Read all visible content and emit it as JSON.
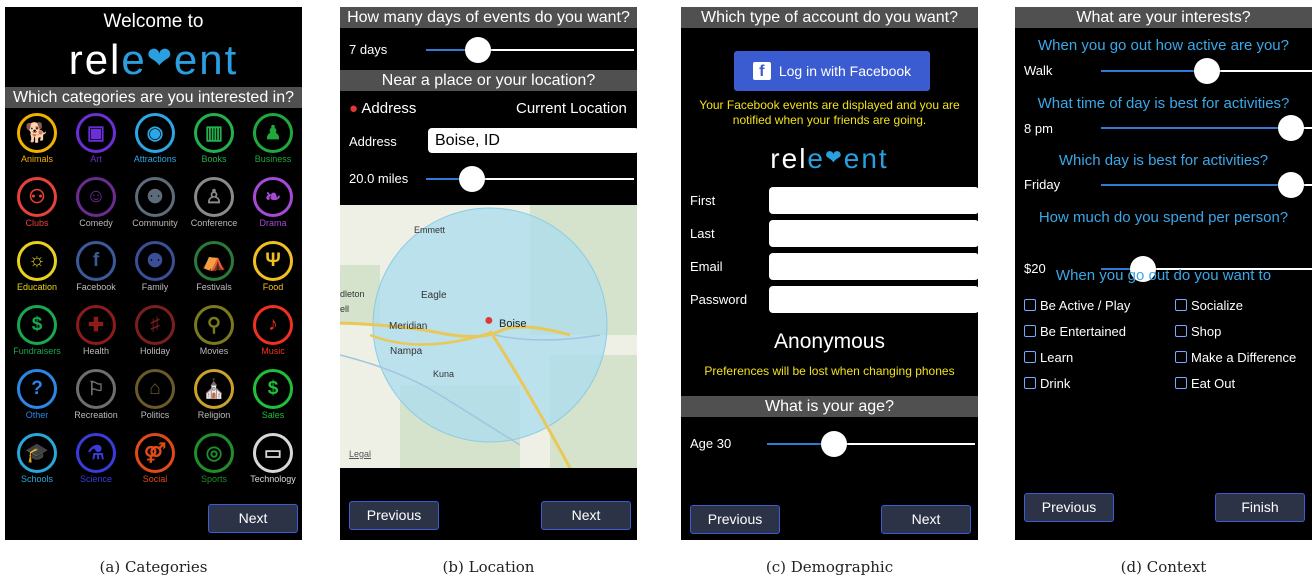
{
  "panel_a": {
    "welcome": "Welcome to",
    "logo": "relevent",
    "header": "Which categories are you interested in?",
    "categories": [
      {
        "label": "Animals",
        "color": "#f2b300",
        "icon": "dog-icon",
        "glyph": "🐕"
      },
      {
        "label": "Art",
        "color": "#6a2fd6",
        "icon": "easel-icon",
        "glyph": "▣"
      },
      {
        "label": "Attractions",
        "color": "#2da6e6",
        "icon": "camera-icon",
        "glyph": "◉"
      },
      {
        "label": "Books",
        "color": "#22b14c",
        "icon": "book-icon",
        "glyph": "▥"
      },
      {
        "label": "Business",
        "color": "#1fa83c",
        "icon": "businessman-icon",
        "glyph": "♟"
      },
      {
        "label": "Clubs",
        "color": "#e6423a",
        "icon": "people-icon",
        "glyph": "⚇"
      },
      {
        "label": "Comedy",
        "color": "#6b2c8f",
        "icon": "masks-icon",
        "glyph": "☺"
      },
      {
        "label": "Community",
        "color": "#5e6b7a",
        "icon": "group-icon",
        "glyph": "⚉"
      },
      {
        "label": "Conference",
        "color": "#8a8a8a",
        "icon": "podium-icon",
        "glyph": "♙"
      },
      {
        "label": "Drama",
        "color": "#a64ad6",
        "icon": "drama-masks-icon",
        "glyph": "❧"
      },
      {
        "label": "Education",
        "color": "#e6d21f",
        "icon": "lightbulb-icon",
        "glyph": "☼"
      },
      {
        "label": "Facebook",
        "color": "#3b5a9a",
        "icon": "facebook-icon",
        "glyph": "f"
      },
      {
        "label": "Family",
        "color": "#3a4f96",
        "icon": "family-icon",
        "glyph": "⚉"
      },
      {
        "label": "Festivals",
        "color": "#2b7a3a",
        "icon": "tent-icon",
        "glyph": "⛺"
      },
      {
        "label": "Food",
        "color": "#f0c020",
        "icon": "fork-knife-icon",
        "glyph": "Ψ"
      },
      {
        "label": "Fundraisers",
        "color": "#19a850",
        "icon": "donation-icon",
        "glyph": "$"
      },
      {
        "label": "Health",
        "color": "#8c1c1c",
        "icon": "health-cross-icon",
        "glyph": "✚"
      },
      {
        "label": "Holiday",
        "color": "#7a1e1e",
        "icon": "candy-cane-icon",
        "glyph": "♯"
      },
      {
        "label": "Movies",
        "color": "#7a7a1a",
        "icon": "film-camera-icon",
        "glyph": "⚲"
      },
      {
        "label": "Music",
        "color": "#f03020",
        "icon": "music-note-icon",
        "glyph": "♪"
      },
      {
        "label": "Other",
        "color": "#2d86e6",
        "icon": "question-icon",
        "glyph": "?"
      },
      {
        "label": "Recreation",
        "color": "#6e6e6e",
        "icon": "runner-icon",
        "glyph": "⚐"
      },
      {
        "label": "Politics",
        "color": "#6a5a2a",
        "icon": "capitol-icon",
        "glyph": "⌂"
      },
      {
        "label": "Religion",
        "color": "#c9a22a",
        "icon": "church-icon",
        "glyph": "⛪"
      },
      {
        "label": "Sales",
        "color": "#1fbf3a",
        "icon": "dollar-icon",
        "glyph": "$"
      },
      {
        "label": "Schools",
        "color": "#28a8d8",
        "icon": "graduation-cap-icon",
        "glyph": "🎓"
      },
      {
        "label": "Science",
        "color": "#3b3bdc",
        "icon": "flask-icon",
        "glyph": "⚗"
      },
      {
        "label": "Social",
        "color": "#e04a18",
        "icon": "couple-icon",
        "glyph": "⚤"
      },
      {
        "label": "Sports",
        "color": "#1f8f2a",
        "icon": "stadium-icon",
        "glyph": "◎"
      },
      {
        "label": "Technology",
        "color": "#d8d8d8",
        "icon": "laptop-icon",
        "glyph": "▭"
      }
    ],
    "next": "Next"
  },
  "panel_b": {
    "days_header": "How many days of events do you want?",
    "days_value": "7 days",
    "days_slider": 0.25,
    "place_header": "Near a place or your location?",
    "address_option": "Address",
    "current_location_option": "Current Location",
    "address_label": "Address",
    "address_value": "Boise, ID",
    "radius_value": "20.0 miles",
    "radius_slider": 0.22,
    "map": {
      "cities": [
        "Emmett",
        "Eagle",
        "Meridian",
        "Boise",
        "Nampa",
        "Kuna"
      ],
      "partial_label": "dleton",
      "partial_label_2": "ell",
      "legal": "Legal"
    },
    "previous": "Previous",
    "next": "Next"
  },
  "panel_c": {
    "header": "Which type of account do you want?",
    "facebook_button": "Log in with Facebook",
    "facebook_note": "Your Facebook events are displayed and you are notified when your friends are going.",
    "logo": "relevent",
    "fields": [
      {
        "label": "First",
        "value": ""
      },
      {
        "label": "Last",
        "value": ""
      },
      {
        "label": "Email",
        "value": ""
      },
      {
        "label": "Password",
        "value": ""
      }
    ],
    "anonymous": "Anonymous",
    "anonymous_note": "Preferences will be lost when changing phones",
    "age_header": "What is your age?",
    "age_value": "Age 30",
    "age_slider": 0.32,
    "previous": "Previous",
    "next": "Next"
  },
  "panel_d": {
    "header": "What are your interests?",
    "q1": "When you go out how active are you?",
    "q1_value": "Walk",
    "q1_slider": 0.5,
    "q2": "What time of day is best for activities?",
    "q2_value": "8 pm",
    "q2_slider": 0.9,
    "q3": "Which day is best for activities?",
    "q3_value": "Friday",
    "q3_slider": 0.9,
    "q4": "How much do you spend per person?",
    "q4_value": "$20",
    "q4_slider": 0.2,
    "q5": "When you go out do you want to",
    "options_left": [
      "Be Active / Play",
      "Be Entertained",
      "Learn",
      "Drink"
    ],
    "options_right": [
      "Socialize",
      "Shop",
      "Make a Difference",
      "Eat Out"
    ],
    "previous": "Previous",
    "finish": "Finish"
  },
  "captions": [
    "(a) Categories",
    "(b) Location",
    "(c) Demographic",
    "(d) Context"
  ]
}
